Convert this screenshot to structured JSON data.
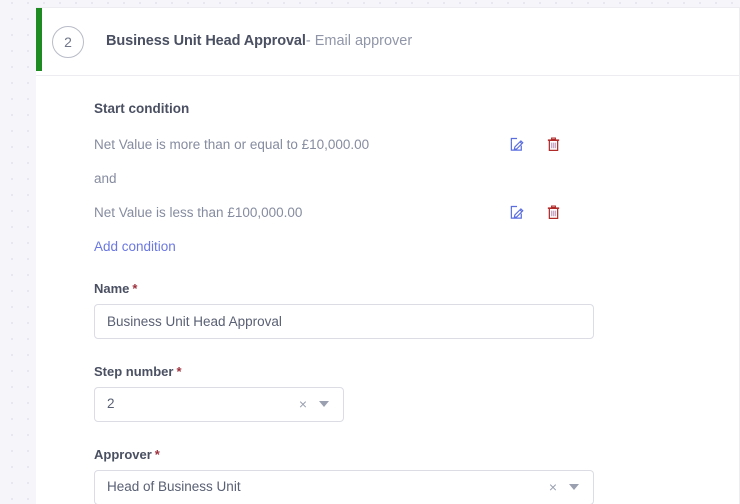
{
  "colors": {
    "accent_green": "#1d8b21",
    "link_blue": "#6b78e0",
    "required_red": "#9e2f3c",
    "edit_icon_blue": "#5b6ee0",
    "delete_icon_red": "#b02a2a",
    "page_background": "#f5f5fa",
    "card_background": "#ffffff",
    "text_primary": "#4a5062",
    "text_muted": "#868ca0"
  },
  "step": {
    "badge_number": "2",
    "title": "Business Unit Head Approval",
    "separator": "-",
    "subtitle": "Email approver"
  },
  "start_condition": {
    "label": "Start condition",
    "conjunction": "and",
    "rows": [
      {
        "text": "Net Value is more than or equal to £10,000.00",
        "edit_icon": "edit-pencil-icon",
        "delete_icon": "trash-icon"
      },
      {
        "text": "Net Value is less than £100,000.00",
        "edit_icon": "edit-pencil-icon",
        "delete_icon": "trash-icon"
      }
    ],
    "add_link": "Add condition"
  },
  "fields": {
    "name": {
      "label": "Name",
      "required_marker": "*",
      "value": "Business Unit Head Approval",
      "placeholder": "Name"
    },
    "step_number": {
      "label": "Step number",
      "required_marker": "*",
      "value": "2",
      "clear_glyph": "×",
      "caret_icon": "chevron-down-icon"
    },
    "approver": {
      "label": "Approver",
      "required_marker": "*",
      "value": "Head of Business Unit",
      "clear_glyph": "×",
      "caret_icon": "chevron-down-icon"
    }
  }
}
